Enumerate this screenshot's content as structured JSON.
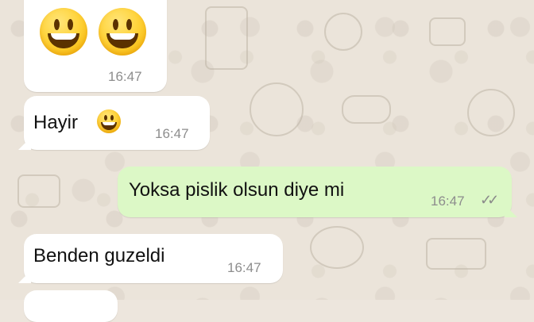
{
  "messages": [
    {
      "emojis": [
        "grinning-face-with-big-eyes",
        "grinning-face-with-big-eyes"
      ],
      "time": "16:47",
      "direction": "incoming"
    },
    {
      "text": "Hayir",
      "emoji": "grinning-face-with-big-eyes",
      "time": "16:47",
      "direction": "incoming"
    },
    {
      "text": "Yoksa pislik olsun diye mi",
      "time": "16:47",
      "direction": "outgoing",
      "status": "read-double-check"
    },
    {
      "text": "Benden guzeldi",
      "time": "16:47",
      "direction": "incoming"
    }
  ],
  "colors": {
    "incoming_bubble": "#ffffff",
    "outgoing_bubble": "#dcf8c6",
    "wallpaper": "#ebe4da"
  }
}
